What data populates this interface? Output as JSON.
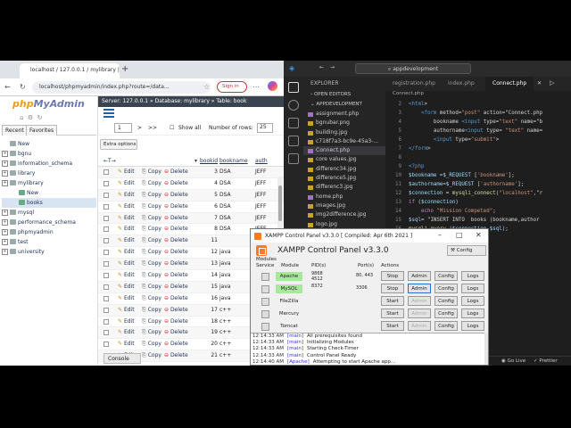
{
  "browser": {
    "tab_title": "localhost / 127.0.0.1 / mylibrary |",
    "url": "localhost/phpmyadmin/index.php?route=/data...",
    "sign_in": "Sign in",
    "pma": {
      "logo_php": "php",
      "logo_myadmin": "MyAdmin",
      "tabs": [
        "Recent",
        "Favorites"
      ],
      "tree": [
        {
          "label": "New",
          "indent": 0,
          "selected": false
        },
        {
          "label": "bgnu",
          "indent": 0,
          "selected": false
        },
        {
          "label": "information_schema",
          "indent": 0,
          "selected": false
        },
        {
          "label": "library",
          "indent": 0,
          "selected": false
        },
        {
          "label": "mylibrary",
          "indent": 0,
          "selected": false
        },
        {
          "label": "New",
          "indent": 1,
          "selected": false
        },
        {
          "label": "books",
          "indent": 1,
          "selected": true
        },
        {
          "label": "mysql",
          "indent": 0,
          "selected": false
        },
        {
          "label": "performance_schema",
          "indent": 0,
          "selected": false
        },
        {
          "label": "phpmyadmin",
          "indent": 0,
          "selected": false
        },
        {
          "label": "test",
          "indent": 0,
          "selected": false
        },
        {
          "label": "university",
          "indent": 0,
          "selected": false
        }
      ],
      "breadcrumb": "Server: 127.0.0.1 » Database: mylibrary » Table: book",
      "page_select": "1",
      "pager_next": ">",
      "pager_last": ">>",
      "show_all": "Show all",
      "number_of_rows": "Number of rows:",
      "rows_select": "25",
      "extra_options": "Extra options",
      "columns": [
        "bookid",
        "bookname",
        "auth"
      ],
      "actions": {
        "edit": "Edit",
        "copy": "Copy",
        "delete": "Delete"
      },
      "rows": [
        {
          "id": "3",
          "name": "DSA",
          "author": "JEFF"
        },
        {
          "id": "4",
          "name": "DSA",
          "author": "JEFF"
        },
        {
          "id": "5",
          "name": "DSA",
          "author": "JEFF"
        },
        {
          "id": "6",
          "name": "DSA",
          "author": "JEFF"
        },
        {
          "id": "7",
          "name": "DSA",
          "author": "JEFF"
        },
        {
          "id": "8",
          "name": "DSA",
          "author": "JEFF"
        },
        {
          "id": "11",
          "name": "",
          "author": ""
        },
        {
          "id": "12",
          "name": "java",
          "author": ""
        },
        {
          "id": "13",
          "name": "java",
          "author": ""
        },
        {
          "id": "14",
          "name": "java",
          "author": ""
        },
        {
          "id": "15",
          "name": "java",
          "author": ""
        },
        {
          "id": "16",
          "name": "java",
          "author": ""
        },
        {
          "id": "17",
          "name": "c++",
          "author": ""
        },
        {
          "id": "18",
          "name": "c++",
          "author": ""
        },
        {
          "id": "19",
          "name": "c++",
          "author": ""
        },
        {
          "id": "20",
          "name": "c++",
          "author": ""
        },
        {
          "id": "21",
          "name": "c++",
          "author": ""
        }
      ],
      "console": "Console"
    }
  },
  "vscode": {
    "search": "appdevelopment",
    "explorer_title": "EXPLORER",
    "open_editors": "OPEN EDITORS",
    "project": "APPDEVELOPMENT",
    "tabs": [
      "registration.php",
      "index.php",
      "Connect.php"
    ],
    "breadcrumb": "Connect.php",
    "files": [
      {
        "name": "assignment.php",
        "color": "#a074c4",
        "active": false
      },
      {
        "name": "bgnubar.png",
        "color": "#c9a227",
        "active": false
      },
      {
        "name": "building.jpg",
        "color": "#c9a227",
        "active": false
      },
      {
        "name": "c718f7a3-bc9e-45a3-...",
        "color": "#c9a227",
        "active": false
      },
      {
        "name": "Connect.php",
        "color": "#a074c4",
        "active": true
      },
      {
        "name": "core values.jpg",
        "color": "#c9a227",
        "active": false
      },
      {
        "name": "differenc34.jpg",
        "color": "#c9a227",
        "active": false
      },
      {
        "name": "difference5.jpg",
        "color": "#c9a227",
        "active": false
      },
      {
        "name": "differenc3.jpg",
        "color": "#c9a227",
        "active": false
      },
      {
        "name": "home.php",
        "color": "#a074c4",
        "active": false
      },
      {
        "name": "images.jpg",
        "color": "#c9a227",
        "active": false
      },
      {
        "name": "img2difference.jpg",
        "color": "#c9a227",
        "active": false
      },
      {
        "name": "logo.jpg",
        "color": "#c9a227",
        "active": false
      }
    ],
    "code_lines": [
      "<html>",
      "    <form method=\"post\" action=\"Connect.php",
      "        bookname <input type=\"text\" name=\"b",
      "        authorname<input type= \"text\" name=",
      "        <input type=\"submit\">",
      "</form>",
      "",
      "<?php",
      "$bookname =$_REQUEST ['bookname'];",
      "$authorname=$_REQUEST ['authorname'];",
      "$connection = mysqli_connect(\"localhost\",\"r",
      "if ($connection)",
      "    echo \"Mission Competed\";",
      "$sql= \"INSERT INTO  books (bookname,author",
      "mysqli_query ($connection,$sql);",
      "?>"
    ],
    "status": {
      "golive": "Go Live",
      "prettier": "Prettier"
    }
  },
  "xampp": {
    "title": "XAMPP Control Panel v3.3.0   [ Compiled: Apr 6th 2021 ]",
    "header": "XAMPP Control Panel v3.3.0",
    "config": "Config",
    "col_modules": "Modules",
    "col_service": "Service",
    "col_module": "Module",
    "col_pids": "PID(s)",
    "col_ports": "Port(s)",
    "col_actions": "Actions",
    "modules": [
      {
        "name": "Apache",
        "pid": "9868\n4512",
        "port": "80, 443",
        "action": "Stop",
        "running": true
      },
      {
        "name": "MySQL",
        "pid": "8372",
        "port": "3306",
        "action": "Stop",
        "running": true
      },
      {
        "name": "FileZilla",
        "pid": "",
        "port": "",
        "action": "Start",
        "running": false
      },
      {
        "name": "Mercury",
        "pid": "",
        "port": "",
        "action": "Start",
        "running": false
      },
      {
        "name": "Tomcat",
        "pid": "",
        "port": "",
        "action": "Start",
        "running": false
      }
    ],
    "btn_admin": "Admin",
    "btn_config": "Config",
    "btn_logs": "Logs",
    "log": [
      {
        "time": "12:14:33 AM",
        "module": "[main]",
        "msg": "All prerequisites found"
      },
      {
        "time": "12:14:33 AM",
        "module": "[main]",
        "msg": "Initializing Modules"
      },
      {
        "time": "12:14:33 AM",
        "module": "[main]",
        "msg": "Starting Check-Timer"
      },
      {
        "time": "12:14:33 AM",
        "module": "[main]",
        "msg": "Control Panel Ready"
      },
      {
        "time": "12:14:40 AM",
        "module": "[Apache]",
        "msg": "Attempting to start Apache app..."
      }
    ]
  }
}
